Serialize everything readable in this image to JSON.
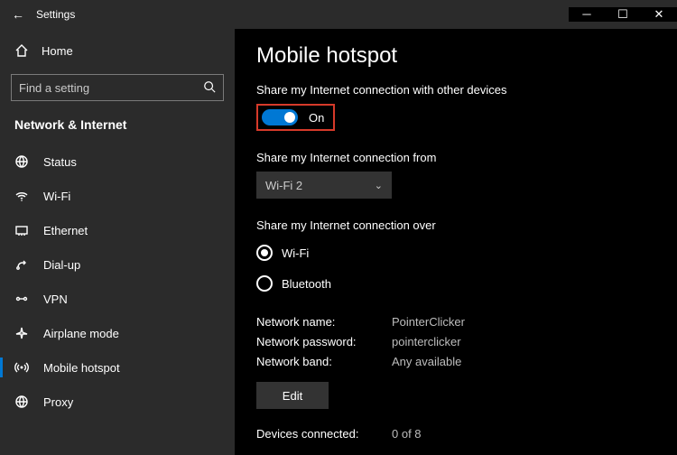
{
  "titlebar": {
    "back_glyph": "←",
    "title": "Settings"
  },
  "sidebar": {
    "home": "Home",
    "search_placeholder": "Find a setting",
    "category": "Network & Internet",
    "items": [
      {
        "label": "Status"
      },
      {
        "label": "Wi-Fi"
      },
      {
        "label": "Ethernet"
      },
      {
        "label": "Dial-up"
      },
      {
        "label": "VPN"
      },
      {
        "label": "Airplane mode"
      },
      {
        "label": "Mobile hotspot"
      },
      {
        "label": "Proxy"
      }
    ]
  },
  "content": {
    "heading": "Mobile hotspot",
    "share_label": "Share my Internet connection with other devices",
    "toggle_state": "On",
    "share_from_label": "Share my Internet connection from",
    "share_from_value": "Wi-Fi 2",
    "share_over_label": "Share my Internet connection over",
    "radio_wifi": "Wi-Fi",
    "radio_bt": "Bluetooth",
    "net_name_k": "Network name:",
    "net_name_v": "PointerClicker",
    "net_pass_k": "Network password:",
    "net_pass_v": "pointerclicker",
    "net_band_k": "Network band:",
    "net_band_v": "Any available",
    "edit": "Edit",
    "devices_k": "Devices connected:",
    "devices_v": "0 of 8"
  }
}
